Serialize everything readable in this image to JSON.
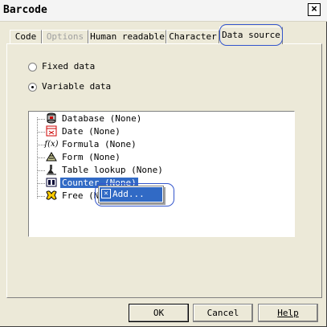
{
  "window": {
    "title": "Barcode",
    "close_label": "×"
  },
  "tabs": [
    {
      "label": "Code",
      "state": "normal"
    },
    {
      "label": "Options",
      "state": "disabled"
    },
    {
      "label": "Human readable",
      "state": "normal"
    },
    {
      "label": "Character",
      "state": "normal"
    },
    {
      "label": "Data source",
      "state": "active"
    }
  ],
  "radios": {
    "fixed": {
      "label": "Fixed data",
      "checked": false
    },
    "variable": {
      "label": "Variable data",
      "checked": true
    }
  },
  "tree": {
    "items": [
      {
        "label": "Database (None)",
        "icon": "database-icon"
      },
      {
        "label": "Date (None)",
        "icon": "calendar-icon"
      },
      {
        "label": "Formula (None)",
        "icon": "formula-icon"
      },
      {
        "label": "Form (None)",
        "icon": "form-icon"
      },
      {
        "label": "Table lookup (None)",
        "icon": "table-lookup-icon"
      },
      {
        "label": "Counter (None)",
        "icon": "counter-icon",
        "selected": true
      },
      {
        "label": "Free (N",
        "icon": "free-icon"
      }
    ]
  },
  "context_menu": {
    "items": [
      {
        "label": "Add..."
      }
    ]
  },
  "buttons": {
    "ok": "OK",
    "cancel": "Cancel",
    "help": "Help"
  },
  "colors": {
    "selection": "#316ac5",
    "annotation": "#3355cc",
    "face": "#ece9d8"
  }
}
